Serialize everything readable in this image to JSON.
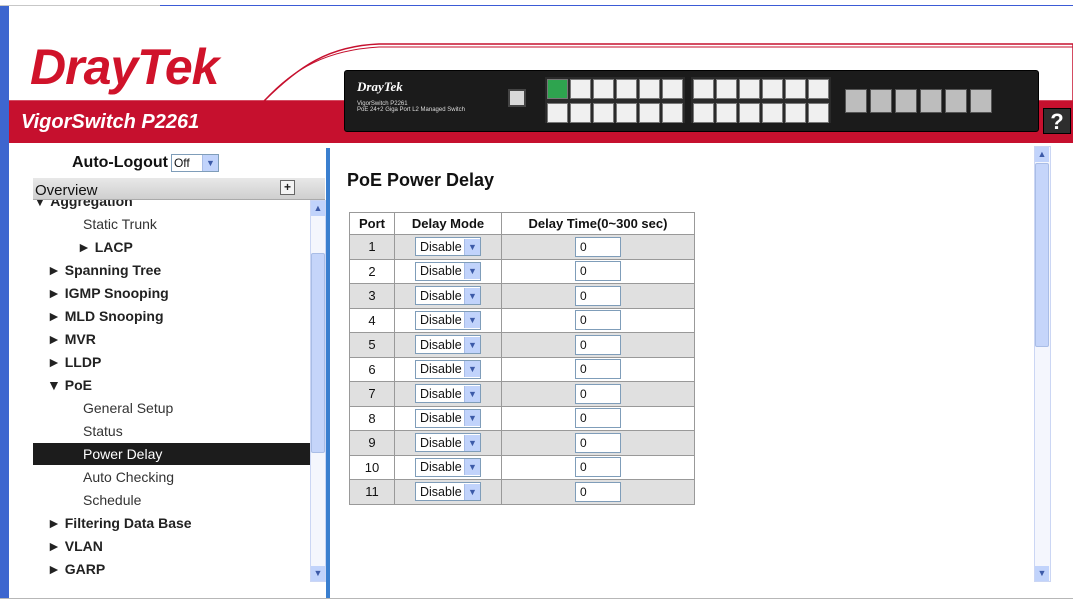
{
  "brand": {
    "logo": "DrayTek",
    "product": "VigorSwitch P2261"
  },
  "device": {
    "brand": "DrayTek",
    "model_line1": "VigorSwitch P2261",
    "model_line2": "PoE 24+2 Giga Port L2 Managed Switch"
  },
  "help": {
    "label": "?",
    "icon": "help-icon"
  },
  "autologout": {
    "label": "Auto-Logout",
    "value": "Off"
  },
  "overview": {
    "label": "Overview",
    "icon": "plus-icon"
  },
  "menu": [
    {
      "label": "▼ Aggregation",
      "kind": "top cut"
    },
    {
      "label": "Static Trunk",
      "kind": "sub"
    },
    {
      "label": "► LACP",
      "kind": "sub2"
    },
    {
      "label": "► Spanning Tree",
      "kind": "top grp"
    },
    {
      "label": "► IGMP Snooping",
      "kind": "top grp"
    },
    {
      "label": "► MLD Snooping",
      "kind": "top grp"
    },
    {
      "label": "► MVR",
      "kind": "top grp"
    },
    {
      "label": "► LLDP",
      "kind": "top grp"
    },
    {
      "label": "▼ PoE",
      "kind": "top grp"
    },
    {
      "label": "General Setup",
      "kind": "sub"
    },
    {
      "label": "Status",
      "kind": "sub"
    },
    {
      "label": "Power Delay",
      "kind": "sub selected"
    },
    {
      "label": "Auto Checking",
      "kind": "sub"
    },
    {
      "label": "Schedule",
      "kind": "sub"
    },
    {
      "label": "► Filtering Data Base",
      "kind": "top grp"
    },
    {
      "label": "► VLAN",
      "kind": "top grp"
    },
    {
      "label": "► GARP",
      "kind": "top grp"
    }
  ],
  "page": {
    "title": "PoE Power Delay"
  },
  "table": {
    "headers": [
      "Port",
      "Delay Mode",
      "Delay Time(0~300 sec)"
    ],
    "rows": [
      {
        "port": "1",
        "mode": "Disable",
        "time": "0"
      },
      {
        "port": "2",
        "mode": "Disable",
        "time": "0"
      },
      {
        "port": "3",
        "mode": "Disable",
        "time": "0"
      },
      {
        "port": "4",
        "mode": "Disable",
        "time": "0"
      },
      {
        "port": "5",
        "mode": "Disable",
        "time": "0"
      },
      {
        "port": "6",
        "mode": "Disable",
        "time": "0"
      },
      {
        "port": "7",
        "mode": "Disable",
        "time": "0"
      },
      {
        "port": "8",
        "mode": "Disable",
        "time": "0"
      },
      {
        "port": "9",
        "mode": "Disable",
        "time": "0"
      },
      {
        "port": "10",
        "mode": "Disable",
        "time": "0"
      },
      {
        "port": "11",
        "mode": "Disable",
        "time": "0"
      }
    ]
  },
  "colors": {
    "brand_red": "#c6102e",
    "accent_blue": "#3a7fcf",
    "selected_bg": "#1c1c1c"
  }
}
